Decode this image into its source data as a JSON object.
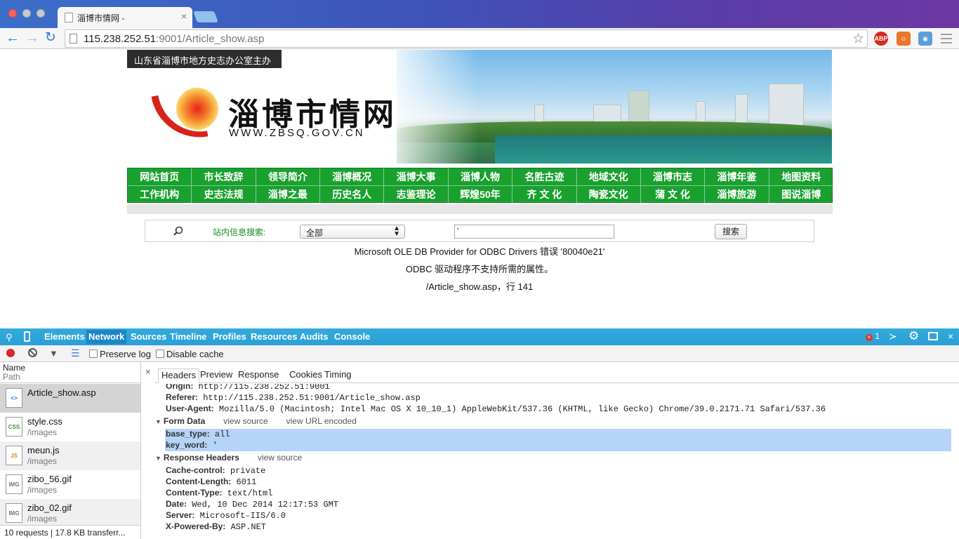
{
  "browser": {
    "tab_title": "淄博市情网 -",
    "url_host": "115.238.252.51",
    "url_rest": ":9001/Article_show.asp",
    "ext_abp": "ABP"
  },
  "site": {
    "host_line": "山东省淄博市地方史志办公室主办",
    "name": "淄博市情网",
    "domain": "WWW.ZBSQ.GOV.CN",
    "nav_row1": [
      "网站首页",
      "市长致辞",
      "领导简介",
      "淄博概况",
      "淄博大事",
      "淄博人物",
      "名胜古迹",
      "地域文化",
      "淄博市志",
      "淄博年鉴",
      "地图资料"
    ],
    "nav_row2": [
      "工作机构",
      "史志法规",
      "淄博之最",
      "历史名人",
      "志鉴理论",
      "辉煌50年",
      "齐 文 化",
      "陶瓷文化",
      "蒲 文 化",
      "淄博旅游",
      "图说淄博"
    ],
    "search": {
      "label": "站内信息搜索:",
      "select_value": "全部",
      "input_value": "'",
      "button": "搜索"
    },
    "error": {
      "line1": "Microsoft OLE DB Provider for ODBC Drivers 错误 '80040e21'",
      "line2": "ODBC 驱动程序不支持所需的属性。",
      "line3": "/Article_show.asp，行 141"
    }
  },
  "devtools": {
    "tabs": [
      "Elements",
      "Network",
      "Sources",
      "Timeline",
      "Profiles",
      "Resources",
      "Audits",
      "Console"
    ],
    "active_tab": "Network",
    "error_count": "1",
    "preserve_log": "Preserve log",
    "disable_cache": "Disable cache",
    "list_header_name": "Name",
    "list_header_path": "Path",
    "requests": [
      {
        "name": "Article_show.asp",
        "path": "",
        "icon": "<>"
      },
      {
        "name": "style.css",
        "path": "/images",
        "icon": "CSS"
      },
      {
        "name": "meun.js",
        "path": "/images",
        "icon": "JS"
      },
      {
        "name": "zibo_56.gif",
        "path": "/images",
        "icon": "IMG"
      },
      {
        "name": "zibo_02.gif",
        "path": "/images",
        "icon": "IMG"
      }
    ],
    "status": "10 requests | 17.8 KB transferr...",
    "detail_tabs": [
      "Headers",
      "Preview",
      "Response",
      "Cookies",
      "Timing"
    ],
    "request_headers": [
      {
        "k": "Origin:",
        "v": "http://115.238.252.51:9001"
      },
      {
        "k": "Referer:",
        "v": "http://115.238.252.51:9001/Article_show.asp"
      },
      {
        "k": "User-Agent:",
        "v": "Mozilla/5.0 (Macintosh; Intel Mac OS X 10_10_1) AppleWebKit/537.36 (KHTML, like Gecko) Chrome/39.0.2171.71 Safari/537.36"
      }
    ],
    "form_data_title": "Form Data",
    "view_source": "view source",
    "view_url_encoded": "view URL encoded",
    "form_data": [
      {
        "k": "base_type:",
        "v": "all"
      },
      {
        "k": "key_word:",
        "v": "'"
      }
    ],
    "response_title": "Response Headers",
    "response_headers": [
      {
        "k": "Cache-control:",
        "v": "private"
      },
      {
        "k": "Content-Length:",
        "v": "6011"
      },
      {
        "k": "Content-Type:",
        "v": "text/html"
      },
      {
        "k": "Date:",
        "v": "Wed, 10 Dec 2014 12:17:53 GMT"
      },
      {
        "k": "Server:",
        "v": "Microsoft-IIS/6.0"
      },
      {
        "k": "X-Powered-By:",
        "v": "ASP.NET"
      }
    ]
  }
}
